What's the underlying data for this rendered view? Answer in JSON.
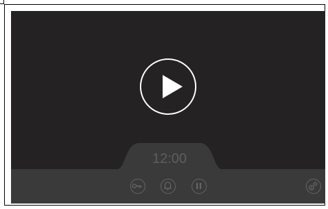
{
  "player": {
    "time": "12:00",
    "icons": {
      "play": "play-icon",
      "door": "key-icon",
      "bell": "bell-icon",
      "pause": "pause-icon",
      "settings": "gears-icon"
    },
    "colors": {
      "screen": "#242223",
      "bar": "#3b3a3b",
      "icon": "#666466",
      "time": "#5f5d5e",
      "play": "#ffffff"
    }
  }
}
